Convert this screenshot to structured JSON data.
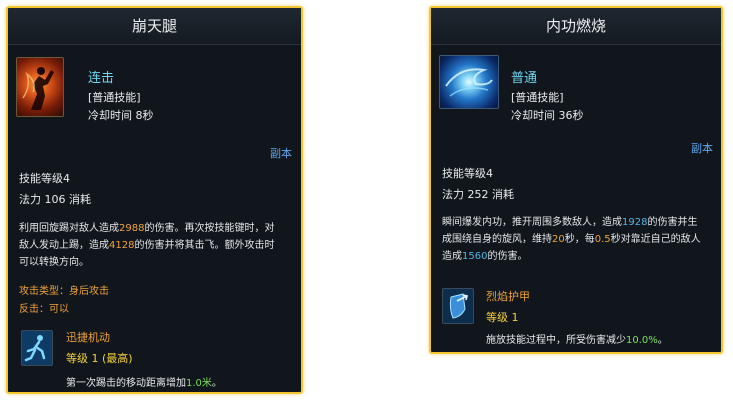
{
  "left_card": {
    "title": "崩天腿",
    "skill_type": "连击",
    "skill_category": "[普通技能]",
    "cooldown": "冷却时间 8秒",
    "copy_label": "副本",
    "skill_level": "技能等级4",
    "mana": "法力 106 消耗",
    "desc_1": "利用回旋踢对敌人造成",
    "dmg_1": "2988",
    "desc_2": "的伤害。再次按技能键时，对",
    "desc_3": "敌人发动上踢，造成",
    "dmg_2": "4128",
    "desc_4": "的伤害并将其击飞。额外攻击时",
    "desc_5": "可以转换方向。",
    "attack_type": "攻击类型：身后攻击",
    "counter": "反击：可以",
    "talent_name": "迅捷机动",
    "talent_level": "等级 1 (最高)",
    "talent_effect_prefix": "第一次踢击的移动距离增加",
    "talent_effect_value": "1.0米",
    "talent_effect_suffix": "。",
    "icon": "kicking-figure-flame-icon",
    "talent_icon": "running-man-icon"
  },
  "right_card": {
    "title": "内功燃烧",
    "skill_type": "普通",
    "skill_category": "[普通技能]",
    "cooldown": "冷却时间 36秒",
    "copy_label": "副本",
    "skill_level": "技能等级4",
    "mana": "法力 252 消耗",
    "desc_1": "瞬间爆发内功，推开周围多数敌人，造成",
    "dmg_1": "1928",
    "desc_2": "的伤害并生",
    "desc_3": "成围绕自身的旋风，维持",
    "duration": "20",
    "desc_4": "秒，每",
    "interval": "0.5",
    "desc_5": "秒对靠近自己的敌人",
    "desc_6": "造成",
    "dmg_2": "1560",
    "desc_7": "的伤害。",
    "talent_name": "烈焰护甲",
    "talent_level": "等级 1",
    "talent_effect_prefix": "施放技能过程中，所受伤害减少",
    "talent_effect_value": "10.0%",
    "talent_effect_suffix": "。",
    "icon": "whirlwind-icon",
    "talent_icon": "shield-arrow-icon"
  }
}
